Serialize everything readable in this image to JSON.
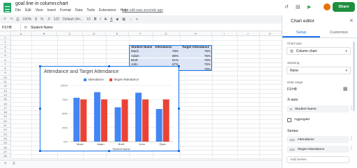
{
  "app": {
    "doc_title": "goal line in column chart",
    "menu": [
      "File",
      "Edit",
      "View",
      "Insert",
      "Format",
      "Data",
      "Tools",
      "Extensions",
      "Help"
    ],
    "last_edit": "Last edit was seconds ago",
    "share_label": "Share"
  },
  "toolbar": {
    "zoom": "100%",
    "currency": "$",
    "percent": "%",
    "decimal": ".0",
    "format_123": "123",
    "font": "Default (Ari...",
    "font_size": "10",
    "bold": "B",
    "italic": "I",
    "strike": "S",
    "text_color": "A"
  },
  "formula_bar": {
    "name_box": "F3:H8",
    "fx": "fx",
    "value": "Student Name"
  },
  "columns": [
    "A",
    "B",
    "C",
    "D",
    "E",
    "F",
    "G",
    "H",
    "I",
    "J",
    "K"
  ],
  "rows": [
    "1",
    "2",
    "3",
    "4",
    "5",
    "6",
    "7",
    "8",
    "9",
    "10",
    "11",
    "12",
    "13",
    "14",
    "15",
    "16",
    "17",
    "18",
    "19",
    "20",
    "21",
    "22",
    "23",
    "24",
    "25",
    "26",
    "27",
    "28"
  ],
  "table": {
    "headers": [
      "Student Name",
      "Attendance",
      "Target Attendance"
    ],
    "rows": [
      [
        "Mack",
        "78%",
        "75%"
      ],
      [
        "Adam",
        "88%",
        "75%"
      ],
      [
        "Brett",
        "61%",
        "75%"
      ],
      [
        "John",
        "87%",
        "75%"
      ],
      [
        "Ryan",
        "58%",
        "75%"
      ]
    ]
  },
  "chart_data": {
    "type": "bar",
    "title": "Attendance and Target Attendance",
    "categories": [
      "Mack",
      "Adam",
      "Brett",
      "John",
      "Ryan"
    ],
    "series": [
      {
        "name": "Attendance",
        "values": [
          78,
          88,
          61,
          87,
          58
        ],
        "color": "#4285f4"
      },
      {
        "name": "Target Attendance",
        "values": [
          75,
          75,
          75,
          75,
          75
        ],
        "color": "#ea4335"
      }
    ],
    "y_ticks": [
      "0%",
      "25%",
      "50%",
      "75%",
      "100%"
    ],
    "ylim": [
      0,
      100
    ],
    "xlabel": "Student Name",
    "ylabel": "",
    "grid": true,
    "legend": "top"
  },
  "editor": {
    "title": "Chart editor",
    "tabs": [
      "Setup",
      "Customize"
    ],
    "chart_type_label": "Chart type",
    "chart_type_value": "Column chart",
    "stacking_label": "Stacking",
    "stacking_value": "None",
    "data_range_label": "Data range",
    "data_range_value": "F3:H8",
    "x_axis_label": "X-axis",
    "x_axis_value": "Student Name",
    "aggregate_label": "Aggregate",
    "series_label": "Series",
    "series": [
      "Attendance",
      "Target Attendance"
    ],
    "add_series": "Add Series",
    "chip_icon": "123",
    "x_icon": "Tt"
  },
  "icons": [
    "star-icon",
    "history-icon",
    "comment-icon",
    "meet-icon",
    "close-icon",
    "more-vert-icon",
    "grid-select-icon"
  ],
  "colors": {
    "accent": "#1a73e8",
    "share": "#1e8e3e",
    "table_fill": "#dce6f7"
  }
}
